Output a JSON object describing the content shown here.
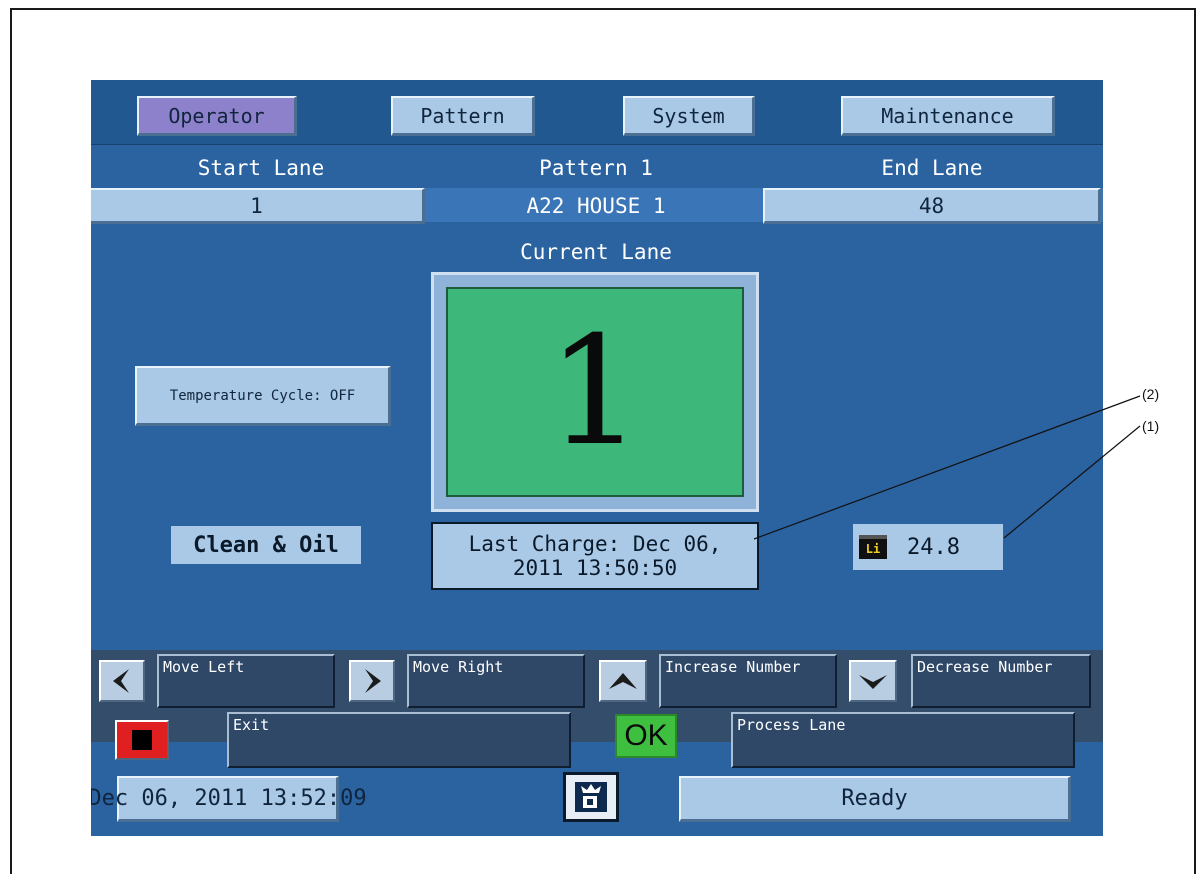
{
  "tabs": {
    "operator": "Operator",
    "pattern": "Pattern",
    "system": "System",
    "maintenance": "Maintenance"
  },
  "header": {
    "start_lane_label": "Start Lane",
    "pattern_label": "Pattern 1",
    "end_lane_label": "End Lane",
    "start_lane_value": "1",
    "pattern_name": "A22 HOUSE 1",
    "end_lane_value": "48",
    "current_lane_label": "Current Lane"
  },
  "current_lane": "1",
  "temperature_cycle": "Temperature Cycle: OFF",
  "mode_label": "Clean & Oil",
  "last_charge": {
    "line1": "Last Charge: Dec 06,",
    "line2": "2011 13:50:50"
  },
  "battery": {
    "icon_text": "Li",
    "value": "24.8"
  },
  "nav_buttons": {
    "move_left": "Move Left",
    "move_right": "Move Right",
    "increase": "Increase Number",
    "decrease": "Decrease Number"
  },
  "action_buttons": {
    "exit": "Exit",
    "ok_icon": "OK",
    "process": "Process Lane"
  },
  "status_bar": {
    "datetime": "Dec 06, 2011 13:52:09",
    "status": "Ready"
  },
  "callouts": {
    "c1": "(1)",
    "c2": "(2)"
  },
  "colors": {
    "screen_bg": "#2b63a0",
    "lane_green": "#3db87a",
    "active_tab": "#8d81cb",
    "stop_red": "#e02020",
    "ok_green": "#3fbf3f"
  }
}
